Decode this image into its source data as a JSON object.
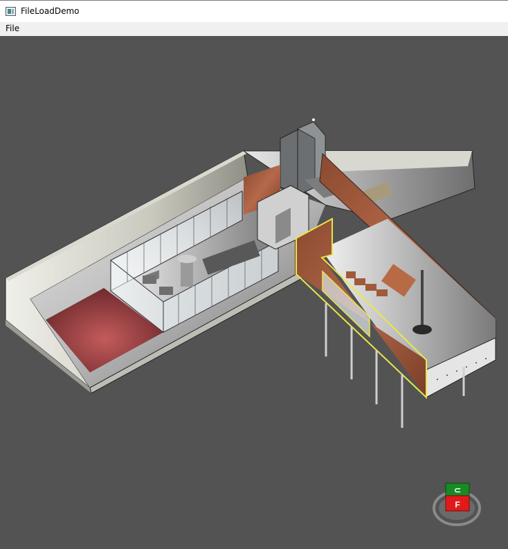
{
  "window": {
    "title": "FileLoadDemo"
  },
  "menu": {
    "items": [
      {
        "label": "File"
      }
    ]
  },
  "gizmo": {
    "top_face": "⊂",
    "front_face": "F"
  }
}
